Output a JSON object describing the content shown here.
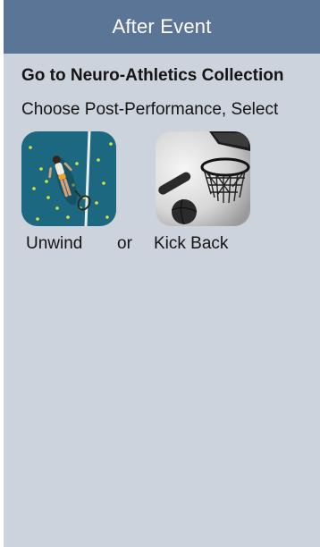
{
  "header": {
    "title": "After Event"
  },
  "content": {
    "headline": "Go to Neuro-Athletics Collection",
    "instruction": "Choose Post-Performance, Select",
    "options": [
      {
        "label": "Unwind",
        "image": "tennis-player-lying-on-court"
      },
      {
        "label": "Kick Back",
        "image": "basketball-hoop-and-ball"
      }
    ],
    "separator": "or"
  },
  "colors": {
    "header_bg": "#5b7597",
    "page_bg": "#cdd3dc",
    "court_blue": "#1e6f87"
  }
}
